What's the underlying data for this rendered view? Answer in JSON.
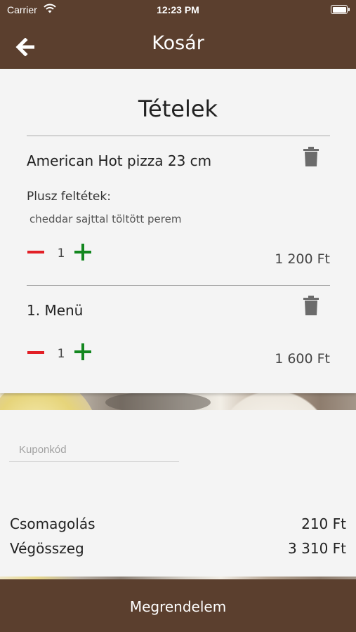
{
  "status_bar": {
    "carrier": "Carrier",
    "time": "12:23 PM"
  },
  "nav": {
    "title": "Kosár"
  },
  "cart": {
    "heading": "Tételek",
    "items": [
      {
        "name": "American Hot pizza 23 cm",
        "extras_label": "Plusz feltétek:",
        "extras": "cheddar sajttal töltött perem",
        "quantity": "1",
        "price": "1 200 Ft"
      },
      {
        "name": "1. Menü",
        "quantity": "1",
        "price": "1 600 Ft"
      }
    ]
  },
  "coupon": {
    "placeholder": "Kuponkód"
  },
  "totals": {
    "packaging_label": "Csomagolás",
    "packaging_value": "210 Ft",
    "total_label": "Végösszeg",
    "total_value": "3 310 Ft"
  },
  "order_button": {
    "label": "Megrendelem"
  },
  "colors": {
    "brand_brown": "#5b3f2e",
    "minus_red": "#e21f26",
    "plus_green": "#13871f",
    "card_bg": "#f4f4f4"
  },
  "icons": {
    "back": "arrow-left-icon",
    "trash": "trash-icon",
    "wifi": "wifi-icon",
    "battery": "battery-icon"
  }
}
